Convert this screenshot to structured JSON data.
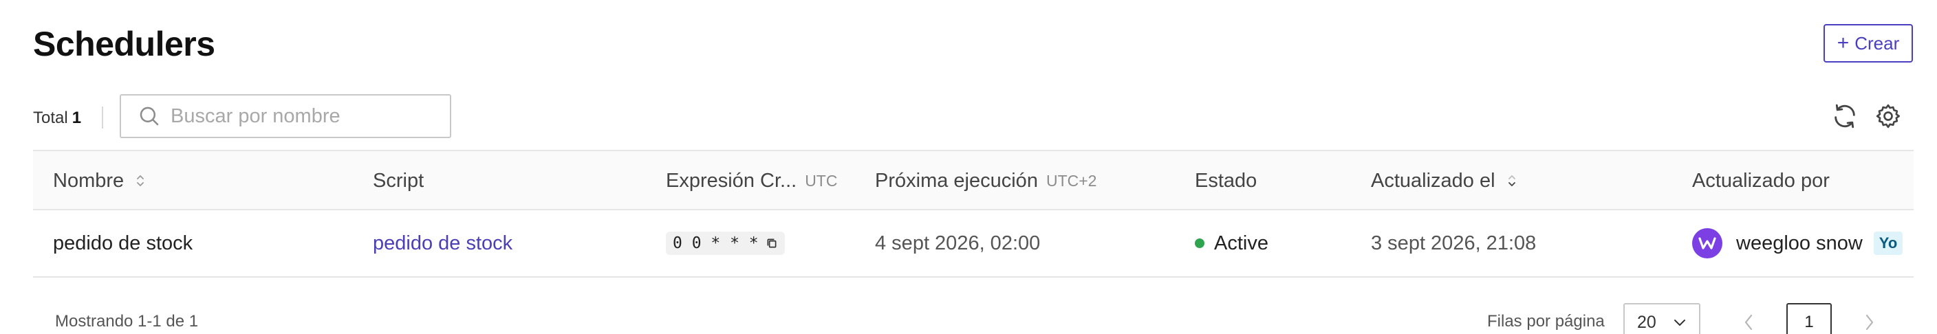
{
  "header": {
    "title": "Schedulers",
    "create_label": "Crear"
  },
  "toolbar": {
    "total_label": "Total",
    "total_count": "1",
    "search_placeholder": "Buscar por nombre",
    "search_value": ""
  },
  "table": {
    "columns": {
      "name": "Nombre",
      "script": "Script",
      "cron": "Expresión Cr...",
      "cron_tz": "UTC",
      "next_run": "Próxima ejecución",
      "next_run_tz": "UTC+2",
      "status": "Estado",
      "updated_at": "Actualizado el",
      "updated_by": "Actualizado por"
    },
    "rows": [
      {
        "name": "pedido de stock",
        "script": "pedido de stock",
        "cron": "0 0 * * *",
        "next_run": "4 sept 2026, 02:00",
        "status": "Active",
        "updated_at": "3 sept 2026, 21:08",
        "updated_by": "weegloo snow",
        "you_badge": "Yo"
      }
    ]
  },
  "footer": {
    "showing": "Mostrando 1-1 de 1",
    "rows_per_page_label": "Filas por página",
    "rows_per_page": "20",
    "current_page": "1"
  },
  "colors": {
    "accent": "#4a3fbf",
    "status_active": "#2ea44f",
    "avatar": "#7b3fe4"
  },
  "icons": {
    "create": "plus-icon",
    "search": "search-icon",
    "refresh": "refresh-icon",
    "settings": "gear-icon",
    "sort": "sort-icon",
    "copy": "copy-icon",
    "prev": "chevron-left-icon",
    "next": "chevron-right-icon",
    "select": "chevron-down-icon"
  }
}
